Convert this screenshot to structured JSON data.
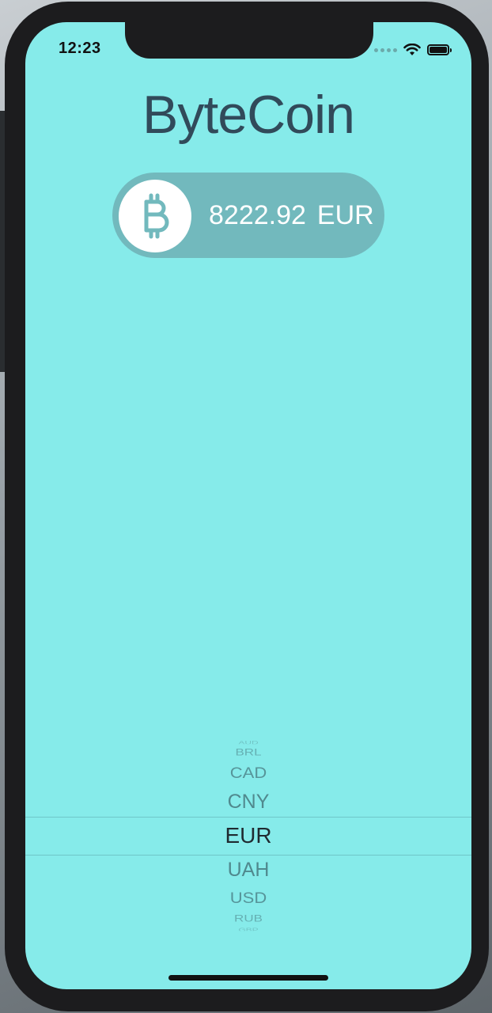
{
  "status_bar": {
    "time": "12:23"
  },
  "app": {
    "title": "ByteCoin"
  },
  "price": {
    "coin_icon": "bitcoin-icon",
    "value": "8222.92",
    "currency": "EUR"
  },
  "currency_picker": {
    "items": [
      "AUD",
      "BRL",
      "CAD",
      "CNY",
      "EUR",
      "UAH",
      "USD",
      "RUB",
      "GBP"
    ],
    "selected": "EUR"
  },
  "colors": {
    "background": "#86ebea",
    "pill": "#72b9bd",
    "title": "#314a5a"
  }
}
